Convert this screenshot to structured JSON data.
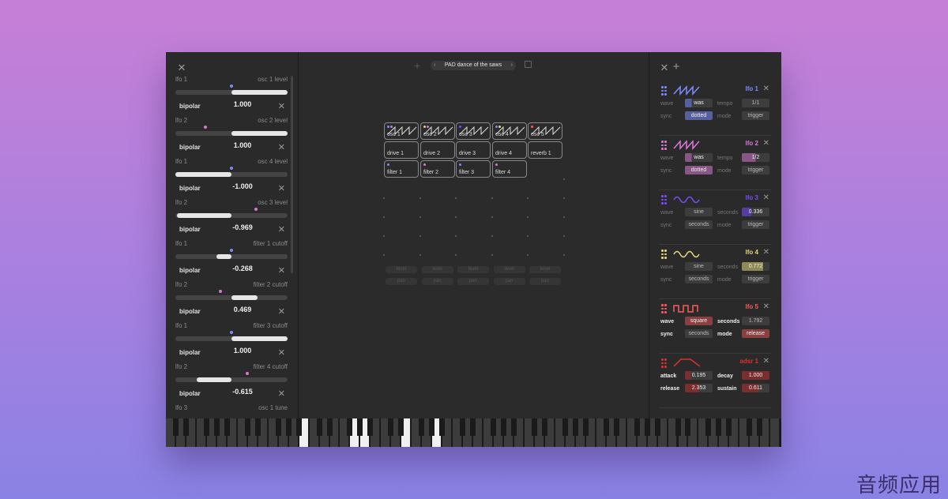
{
  "preset": {
    "name": "PAD dance of the saws"
  },
  "modulations": [
    {
      "source": "lfo 1",
      "destination": "osc 1 level",
      "bipolar_label": "bipolar",
      "amount": "1.000",
      "fill_from": 0.5,
      "fill_to": 1.0,
      "dot_pos": 0.5,
      "dot_color": "#7b8cff"
    },
    {
      "source": "lfo 2",
      "destination": "osc 2 level",
      "bipolar_label": "bipolar",
      "amount": "1.000",
      "fill_from": 0.5,
      "fill_to": 1.0,
      "dot_pos": 0.27,
      "dot_color": "#d77ad6"
    },
    {
      "source": "lfo 1",
      "destination": "osc 4 level",
      "bipolar_label": "bipolar",
      "amount": "-1.000",
      "fill_from": 0.0,
      "fill_to": 0.5,
      "dot_pos": 0.5,
      "dot_color": "#7b8cff"
    },
    {
      "source": "lfo 2",
      "destination": "osc 3 level",
      "bipolar_label": "bipolar",
      "amount": "-0.969",
      "fill_from": 0.015,
      "fill_to": 0.5,
      "dot_pos": 0.72,
      "dot_color": "#d77ad6"
    },
    {
      "source": "lfo 1",
      "destination": "filter 1 cutoff",
      "bipolar_label": "bipolar",
      "amount": "-0.268",
      "fill_from": 0.366,
      "fill_to": 0.5,
      "dot_pos": 0.5,
      "dot_color": "#7b8cff"
    },
    {
      "source": "lfo 2",
      "destination": "filter 2 cutoff",
      "bipolar_label": "bipolar",
      "amount": "0.469",
      "fill_from": 0.5,
      "fill_to": 0.735,
      "dot_pos": 0.4,
      "dot_color": "#d77ad6"
    },
    {
      "source": "lfo 1",
      "destination": "filter 3 cutoff",
      "bipolar_label": "bipolar",
      "amount": "1.000",
      "fill_from": 0.5,
      "fill_to": 1.0,
      "dot_pos": 0.5,
      "dot_color": "#7b8cff"
    },
    {
      "source": "lfo 2",
      "destination": "filter 4 cutoff",
      "bipolar_label": "bipolar",
      "amount": "-0.615",
      "fill_from": 0.19,
      "fill_to": 0.5,
      "dot_pos": 0.64,
      "dot_color": "#d77ad6"
    },
    {
      "source": "lfo 3",
      "destination": "osc 1 tune",
      "bipolar_label": "",
      "amount": "",
      "fill_from": 0,
      "fill_to": 0,
      "dot_pos": 0,
      "dot_color": "#7b4bff"
    }
  ],
  "grid": {
    "row1": [
      "osc 1",
      "osc 2",
      "osc 3",
      "osc 4",
      "osc 5"
    ],
    "row2": [
      "drive 1",
      "drive 2",
      "drive 3",
      "drive 4",
      "reverb 1"
    ],
    "row3": [
      "filter 1",
      "filter 2",
      "filter 3",
      "filter 4"
    ],
    "mixer": {
      "level": "level",
      "pan": "pan"
    }
  },
  "lfos": [
    {
      "name": "lfo 1",
      "color": "#7b8cff",
      "shape": "saw",
      "k1": "wave",
      "v1": "was",
      "k2": "tempo",
      "v2": "1/1",
      "k3": "sync",
      "v3": "dotted",
      "k4": "mode",
      "v4": "trigger",
      "bold": false,
      "fill1": 0.25,
      "fill2": 0,
      "fill3": 1.0
    },
    {
      "name": "lfo 2",
      "color": "#d77ad6",
      "shape": "saw",
      "k1": "wave",
      "v1": "was",
      "k2": "tempo",
      "v2": "1/2",
      "k3": "sync",
      "v3": "dotted",
      "k4": "mode",
      "v4": "trigger",
      "bold": false,
      "fill1": 0.25,
      "fill2": 0.5,
      "fill3": 1.0
    },
    {
      "name": "lfo 3",
      "color": "#7b4bff",
      "shape": "sine",
      "k1": "wave",
      "v1": "sine",
      "k2": "seconds",
      "v2": "0.336",
      "k3": "sync",
      "v3": "seconds",
      "k4": "mode",
      "v4": "trigger",
      "bold": false,
      "fill1": 0,
      "fill2": 0.34,
      "fill3": 0
    },
    {
      "name": "lfo 4",
      "color": "#e5d77a",
      "shape": "sine",
      "k1": "wave",
      "v1": "sine",
      "k2": "seconds",
      "v2": "0.772",
      "k3": "sync",
      "v3": "seconds",
      "k4": "mode",
      "v4": "trigger",
      "bold": false,
      "fill1": 0,
      "fill2": 0.77,
      "fill3": 0
    },
    {
      "name": "lfo 5",
      "color": "#ff5a5a",
      "shape": "square",
      "k1": "wave",
      "v1": "square",
      "k2": "seconds",
      "v2": "1.792",
      "k3": "sync",
      "v3": "seconds",
      "k4": "mode",
      "v4": "release",
      "bold": true,
      "fill1": 1.0,
      "fill2": 0,
      "fill3": 0,
      "fill4": 1.0
    },
    {
      "name": "adsr 1",
      "color": "#e03030",
      "shape": "env",
      "k1": "attack",
      "v1": "0.195",
      "k2": "decay",
      "v2": "1.000",
      "k3": "release",
      "v3": "2.353",
      "k4": "sustain",
      "v4": "0.611",
      "bold": true,
      "fill1": 0.2,
      "fill2": 1.0,
      "fill3": 0.5,
      "fill4": 0.61
    }
  ],
  "keyboard": {
    "active_white_keys": [
      13,
      18,
      19,
      23,
      26
    ]
  },
  "watermark": "音频应用"
}
